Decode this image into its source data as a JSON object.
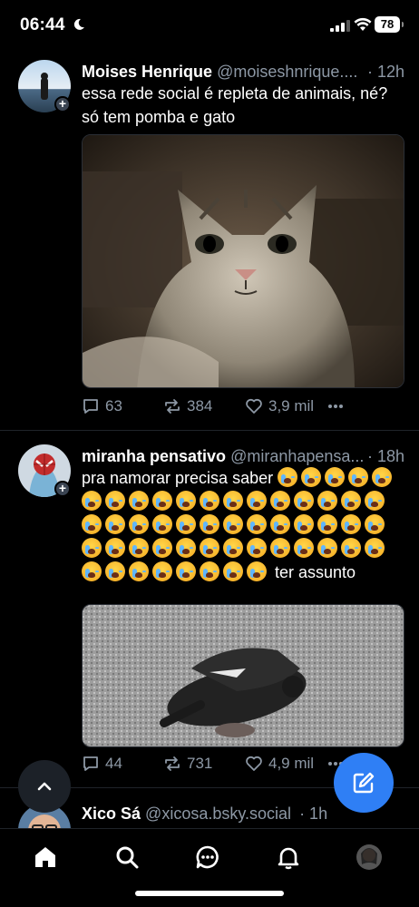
{
  "status_bar": {
    "time": "06:44",
    "battery": "78"
  },
  "posts": [
    {
      "display_name": "Moises Henrique",
      "handle": "@moiseshnrique....",
      "time": "· 12h",
      "text": "essa rede social é repleta de animais, né? só tem pomba e gato",
      "media_icon": "cat-photo",
      "replies": "63",
      "reposts": "384",
      "likes": "3,9 mil"
    },
    {
      "display_name": "miranha pensativo",
      "handle": "@miranhapensa...",
      "time": "· 18h",
      "text_prefix": "pra namorar precisa saber",
      "emoji_name": "loudly-crying-face",
      "emoji_count_first_line": 5,
      "emoji_count_after": 47,
      "text_suffix": "ter assunto",
      "media_icon": "pigeon-photo",
      "replies": "44",
      "reposts": "731",
      "likes": "4,9 mil"
    },
    {
      "display_name": "Xico Sá",
      "handle": "@xicosa.bsky.social",
      "time": "· 1h"
    }
  ],
  "nav": {
    "items": [
      "home-icon",
      "search-icon",
      "chat-icon",
      "bell-icon",
      "profile-avatar"
    ]
  },
  "colors": {
    "accent": "#2f7ff5",
    "muted": "#8d98a5",
    "background": "#000000"
  }
}
